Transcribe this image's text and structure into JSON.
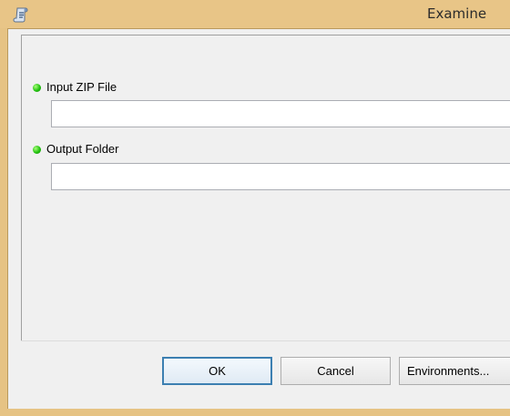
{
  "window": {
    "title": "Examine",
    "icon": "script-scroll-icon"
  },
  "parameters": [
    {
      "label": "Input ZIP File",
      "value": "",
      "required": true
    },
    {
      "label": "Output Folder",
      "value": "",
      "required": true
    }
  ],
  "buttons": {
    "ok": "OK",
    "cancel": "Cancel",
    "environments": "Environments..."
  },
  "colors": {
    "titlebar": "#e8c587",
    "required_dot": "#22c10f",
    "dialog_bg": "#f0f0f0",
    "default_button_border": "#3c7fb1"
  }
}
